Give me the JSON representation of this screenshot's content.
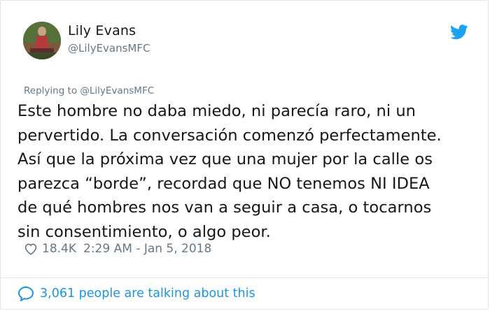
{
  "user": {
    "name": "Lily Evans",
    "handle": "@LilyEvansMFC"
  },
  "tweet": {
    "replying_to": "Replying to @LilyEvansMFC",
    "lines": [
      "Este hombre no daba miedo, ni parecía raro, ni un",
      "pervertido. La conversación comenzó perfectamente.",
      "Así que la próxima vez que una mujer por la calle os",
      "parezca “borde”, recordad que NO tenemos NI IDEA",
      "de qué hombres nos van a seguir a casa, o tocarnos",
      "sin consentimiento, o algo peor."
    ],
    "likes": "18.4K",
    "timestamp": "2:29 AM - Jan 5, 2018"
  },
  "footer": {
    "conversation_text": "3,061 people are talking about this"
  },
  "icons": {
    "brand": "twitter-bird-icon",
    "like": "heart-icon",
    "reply": "speech-bubble-icon"
  },
  "colors": {
    "twitter_blue": "#1da1f2",
    "link_blue": "#1b95e0",
    "secondary_text": "#657786",
    "primary_text": "#14171a",
    "border": "#e1e8ed"
  }
}
